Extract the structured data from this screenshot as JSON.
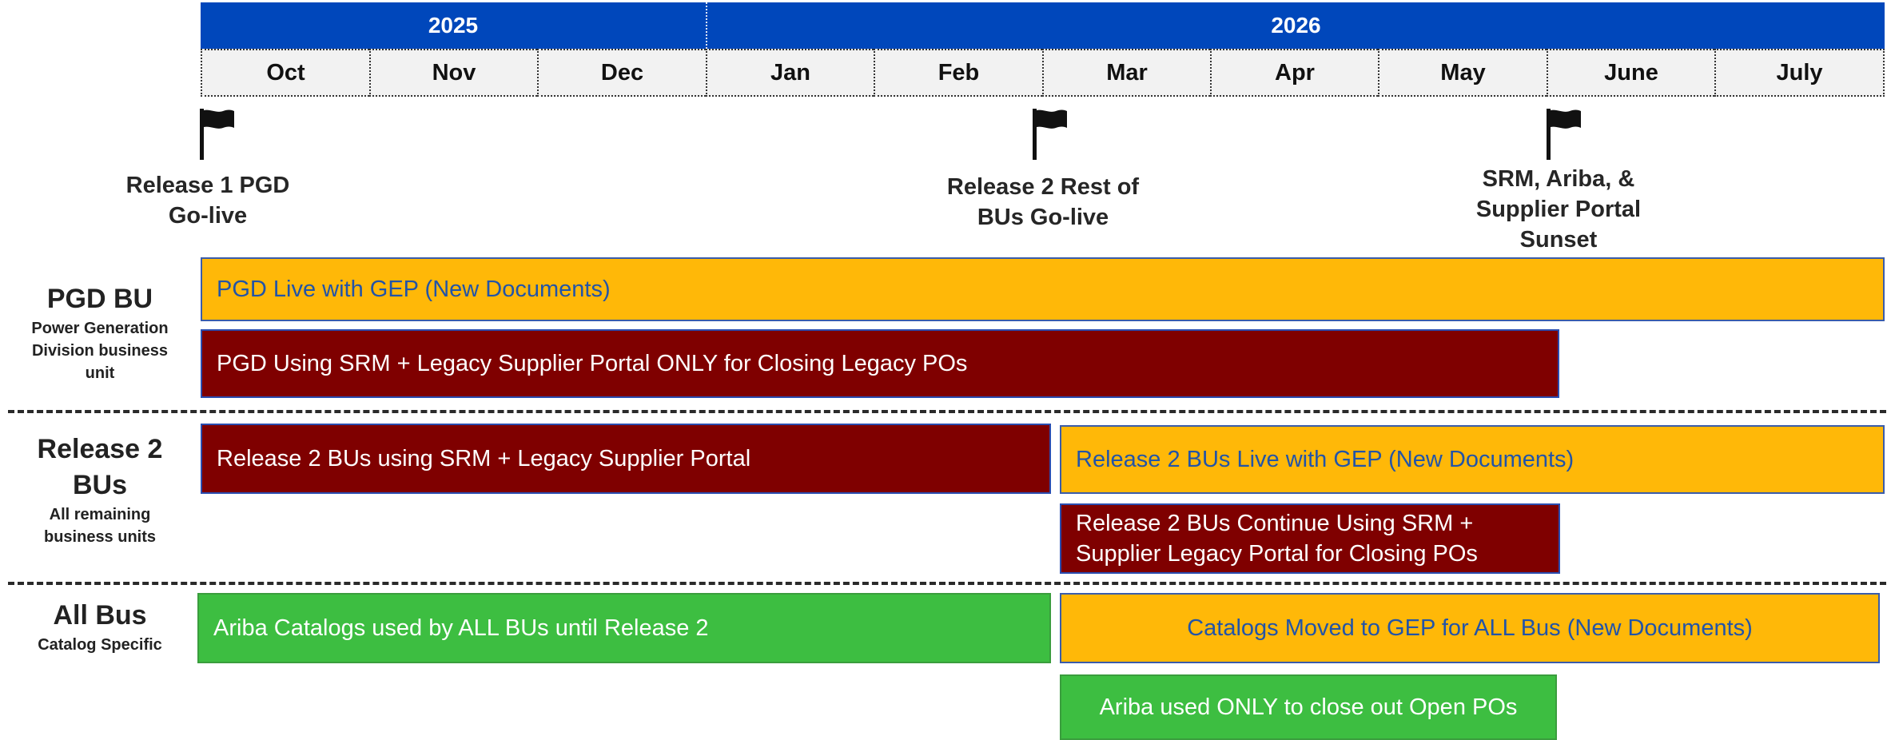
{
  "timeline": {
    "years": [
      {
        "label": "2025"
      },
      {
        "label": "2026"
      }
    ],
    "months": [
      "Oct",
      "Nov",
      "Dec",
      "Jan",
      "Feb",
      "Mar",
      "Apr",
      "May",
      "June",
      "July"
    ]
  },
  "milestones": [
    {
      "line1": "Release 1 PGD",
      "line2": "Go-live",
      "line3": ""
    },
    {
      "line1": "Release 2 Rest of",
      "line2": "BUs Go-live",
      "line3": ""
    },
    {
      "line1": "SRM, Ariba, &",
      "line2": "Supplier Portal",
      "line3": "Sunset"
    }
  ],
  "sections": {
    "pgd": {
      "title": "PGD BU",
      "sub1": "Power Generation",
      "sub2": "Division business",
      "sub3": "unit",
      "bars": [
        {
          "label": "PGD Live with GEP  (New Documents)",
          "color": "#FFB808"
        },
        {
          "label": "PGD Using SRM + Legacy Supplier Portal  ONLY for Closing Legacy POs",
          "color": "#7F0000"
        }
      ]
    },
    "release2": {
      "title1": "Release 2",
      "title2": "BUs",
      "sub1": "All remaining",
      "sub2": "business units",
      "bars": [
        {
          "label": "Release 2 BUs using SRM + Legacy Supplier Portal",
          "color": "#7F0000"
        },
        {
          "label": "Release 2 BUs Live with GEP (New Documents)",
          "color": "#FFB808"
        },
        {
          "line1": "Release 2 BUs Continue Using SRM +",
          "line2": "Supplier Legacy Portal for Closing POs",
          "color": "#7F0000"
        }
      ]
    },
    "allbus": {
      "title": "All Bus",
      "sub1": "Catalog Specific",
      "bars": [
        {
          "label": "Ariba Catalogs used by ALL BUs until Release 2",
          "color": "#3DBE41"
        },
        {
          "label": "Catalogs Moved to GEP for ALL Bus (New Documents)",
          "color": "#FFB808"
        },
        {
          "label": "Ariba used ONLY to close out Open POs",
          "color": "#3DBE41"
        }
      ]
    }
  }
}
